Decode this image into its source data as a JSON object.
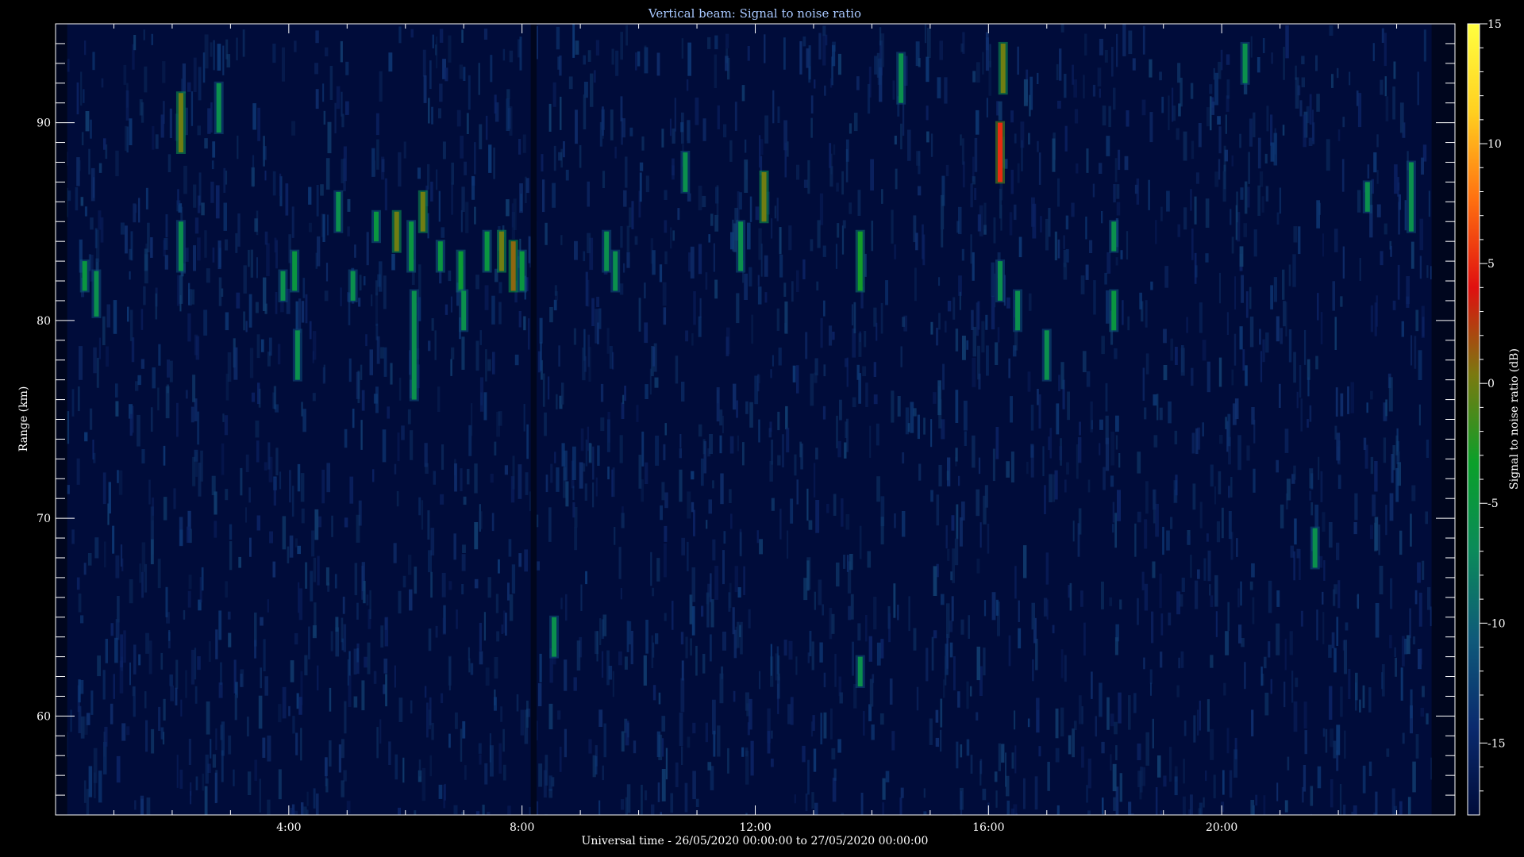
{
  "chart_data": {
    "type": "heatmap",
    "title": "Vertical beam: Signal to noise ratio",
    "xlabel": "Universal time - 26/05/2020 00:00:00 to 27/05/2020 00:00:00",
    "ylabel": "Range (km)",
    "colorbar_label": "Signal to noise ratio (dB)",
    "xlim_hours": [
      0,
      24
    ],
    "ylim_km": [
      55,
      95
    ],
    "zlim_db": [
      -18,
      15
    ],
    "x_ticks": [
      {
        "value": 4,
        "label": "4:00"
      },
      {
        "value": 8,
        "label": "8:00"
      },
      {
        "value": 12,
        "label": "12:00"
      },
      {
        "value": 16,
        "label": "16:00"
      },
      {
        "value": 20,
        "label": "20:00"
      }
    ],
    "y_ticks": [
      {
        "value": 60,
        "label": "60"
      },
      {
        "value": 70,
        "label": "70"
      },
      {
        "value": 80,
        "label": "80"
      },
      {
        "value": 90,
        "label": "90"
      }
    ],
    "colorbar_ticks": [
      {
        "value": -15,
        "label": "-15"
      },
      {
        "value": -10,
        "label": "-10"
      },
      {
        "value": -5,
        "label": "-5"
      },
      {
        "value": 0,
        "label": "0"
      },
      {
        "value": 5,
        "label": "5"
      },
      {
        "value": 10,
        "label": "10"
      },
      {
        "value": 15,
        "label": "15"
      }
    ],
    "colormap": [
      "#000c3a",
      "#0a2a6e",
      "#0f5a7a",
      "#0b8a5a",
      "#0aa02a",
      "#7a7a10",
      "#e01010",
      "#ff7010",
      "#ffd020",
      "#ffff40"
    ],
    "background_db": -16,
    "data_gaps": [
      {
        "t_start": 0.0,
        "t_end": 0.2
      },
      {
        "t_start": 8.15,
        "t_end": 8.25
      },
      {
        "t_start": 23.6,
        "t_end": 24.0
      }
    ],
    "features": [
      {
        "t": 2.15,
        "r_min": 88.5,
        "r_max": 91.5,
        "db": 0
      },
      {
        "t": 2.15,
        "r_min": 82.5,
        "r_max": 85.0,
        "db": -6
      },
      {
        "t": 2.8,
        "r_min": 89.5,
        "r_max": 92.0,
        "db": -6
      },
      {
        "t": 0.5,
        "r_min": 81.5,
        "r_max": 83.0,
        "db": -5
      },
      {
        "t": 0.7,
        "r_min": 80.2,
        "r_max": 82.5,
        "db": -6
      },
      {
        "t": 3.9,
        "r_min": 81.0,
        "r_max": 82.5,
        "db": -6
      },
      {
        "t": 4.1,
        "r_min": 81.5,
        "r_max": 83.5,
        "db": -5
      },
      {
        "t": 4.15,
        "r_min": 77.0,
        "r_max": 79.5,
        "db": -6
      },
      {
        "t": 4.85,
        "r_min": 84.5,
        "r_max": 86.5,
        "db": -6
      },
      {
        "t": 5.1,
        "r_min": 81.0,
        "r_max": 82.5,
        "db": -6
      },
      {
        "t": 5.5,
        "r_min": 84.0,
        "r_max": 85.5,
        "db": -5
      },
      {
        "t": 5.85,
        "r_min": 83.5,
        "r_max": 85.5,
        "db": 0
      },
      {
        "t": 6.1,
        "r_min": 82.5,
        "r_max": 85.0,
        "db": -5
      },
      {
        "t": 6.15,
        "r_min": 76.0,
        "r_max": 81.5,
        "db": -6
      },
      {
        "t": 6.3,
        "r_min": 84.5,
        "r_max": 86.5,
        "db": 0
      },
      {
        "t": 6.6,
        "r_min": 82.5,
        "r_max": 84.0,
        "db": -5
      },
      {
        "t": 6.95,
        "r_min": 81.5,
        "r_max": 83.5,
        "db": -4
      },
      {
        "t": 7.0,
        "r_min": 79.5,
        "r_max": 81.5,
        "db": -6
      },
      {
        "t": 7.4,
        "r_min": 82.5,
        "r_max": 84.5,
        "db": -5
      },
      {
        "t": 7.65,
        "r_min": 82.5,
        "r_max": 84.5,
        "db": 0
      },
      {
        "t": 7.85,
        "r_min": 81.5,
        "r_max": 84.0,
        "db": 1
      },
      {
        "t": 8.0,
        "r_min": 81.5,
        "r_max": 83.5,
        "db": -5
      },
      {
        "t": 8.55,
        "r_min": 63.0,
        "r_max": 65.0,
        "db": -6
      },
      {
        "t": 9.45,
        "r_min": 82.5,
        "r_max": 84.5,
        "db": -6
      },
      {
        "t": 9.6,
        "r_min": 81.5,
        "r_max": 83.5,
        "db": -6
      },
      {
        "t": 10.8,
        "r_min": 86.5,
        "r_max": 88.5,
        "db": -6
      },
      {
        "t": 11.75,
        "r_min": 82.5,
        "r_max": 85.0,
        "db": -6
      },
      {
        "t": 12.15,
        "r_min": 85.0,
        "r_max": 87.5,
        "db": 0
      },
      {
        "t": 13.8,
        "r_min": 81.5,
        "r_max": 84.5,
        "db": -3
      },
      {
        "t": 13.8,
        "r_min": 61.5,
        "r_max": 63.0,
        "db": -6
      },
      {
        "t": 14.5,
        "r_min": 91.0,
        "r_max": 93.5,
        "db": -6
      },
      {
        "t": 16.2,
        "r_min": 87.0,
        "r_max": 90.0,
        "db": 5
      },
      {
        "t": 16.25,
        "r_min": 91.5,
        "r_max": 94.0,
        "db": 0
      },
      {
        "t": 16.2,
        "r_min": 81.0,
        "r_max": 83.0,
        "db": -6
      },
      {
        "t": 16.5,
        "r_min": 79.5,
        "r_max": 81.5,
        "db": -6
      },
      {
        "t": 17.0,
        "r_min": 77.0,
        "r_max": 79.5,
        "db": -6
      },
      {
        "t": 18.15,
        "r_min": 79.5,
        "r_max": 81.5,
        "db": -5
      },
      {
        "t": 18.15,
        "r_min": 83.5,
        "r_max": 85.0,
        "db": -6
      },
      {
        "t": 20.4,
        "r_min": 92.0,
        "r_max": 94.0,
        "db": -6
      },
      {
        "t": 21.6,
        "r_min": 67.5,
        "r_max": 69.5,
        "db": -6
      },
      {
        "t": 22.5,
        "r_min": 85.5,
        "r_max": 87.0,
        "db": -6
      },
      {
        "t": 23.25,
        "r_min": 84.5,
        "r_max": 88.0,
        "db": -6
      }
    ]
  }
}
